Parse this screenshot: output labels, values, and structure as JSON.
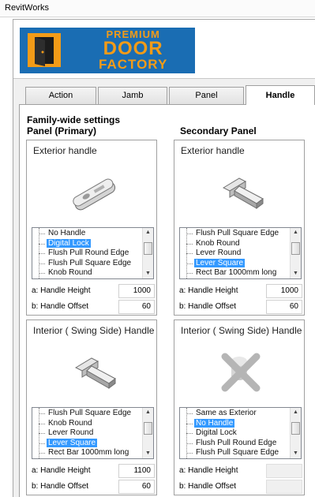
{
  "window": {
    "title": "RevitWorks"
  },
  "logo": {
    "line1": "PREMIUM",
    "line2": "DOOR",
    "line3": "FACTORY"
  },
  "tabs": [
    {
      "label": "Action",
      "active": false
    },
    {
      "label": "Jamb",
      "active": false
    },
    {
      "label": "Panel",
      "active": false
    },
    {
      "label": "Handle",
      "active": true
    }
  ],
  "headings": {
    "family_wide": "Family-wide settings",
    "primary": "Panel (Primary)",
    "secondary": "Secondary Panel"
  },
  "groups": {
    "primary_exterior": {
      "title": "Exterior handle",
      "image_icon": "digital-lock-handle",
      "items": [
        "No Handle",
        "Digital Lock",
        "Flush Pull Round Edge",
        "Flush Pull Square Edge",
        "Knob Round"
      ],
      "selected": "Digital Lock",
      "height_label": "a: Handle Height",
      "height_value": "1000",
      "offset_label": "b: Handle Offset",
      "offset_value": "60"
    },
    "secondary_exterior": {
      "title": "Exterior handle",
      "image_icon": "lever-square-handle",
      "items": [
        "Flush Pull Square Edge",
        "Knob Round",
        "Lever Round",
        "Lever Square",
        "Rect Bar 1000mm long"
      ],
      "selected": "Lever Square",
      "height_label": "a: Handle Height",
      "height_value": "1000",
      "offset_label": "b: Handle Offset",
      "offset_value": "60"
    },
    "primary_interior": {
      "title": "Interior ( Swing Side) Handle",
      "image_icon": "lever-square-handle",
      "items": [
        "Flush Pull Square Edge",
        "Knob Round",
        "Lever Round",
        "Lever Square",
        "Rect Bar 1000mm long"
      ],
      "selected": "Lever Square",
      "height_label": "a: Handle Height",
      "height_value": "1100",
      "offset_label": "b: Handle Offset",
      "offset_value": "60"
    },
    "secondary_interior": {
      "title": "Interior ( Swing Side) Handle",
      "image_icon": "no-handle-icon",
      "items": [
        "Same as Exterior",
        "No Handle",
        "Digital Lock",
        "Flush Pull Round Edge",
        "Flush Pull Square Edge"
      ],
      "selected": "No Handle",
      "height_label": "a: Handle Height",
      "height_value": "",
      "offset_label": "b: Handle Offset",
      "offset_value": ""
    }
  },
  "colors": {
    "brand_blue": "#1a6db3",
    "brand_orange": "#f29b18",
    "selection": "#3399ff"
  }
}
